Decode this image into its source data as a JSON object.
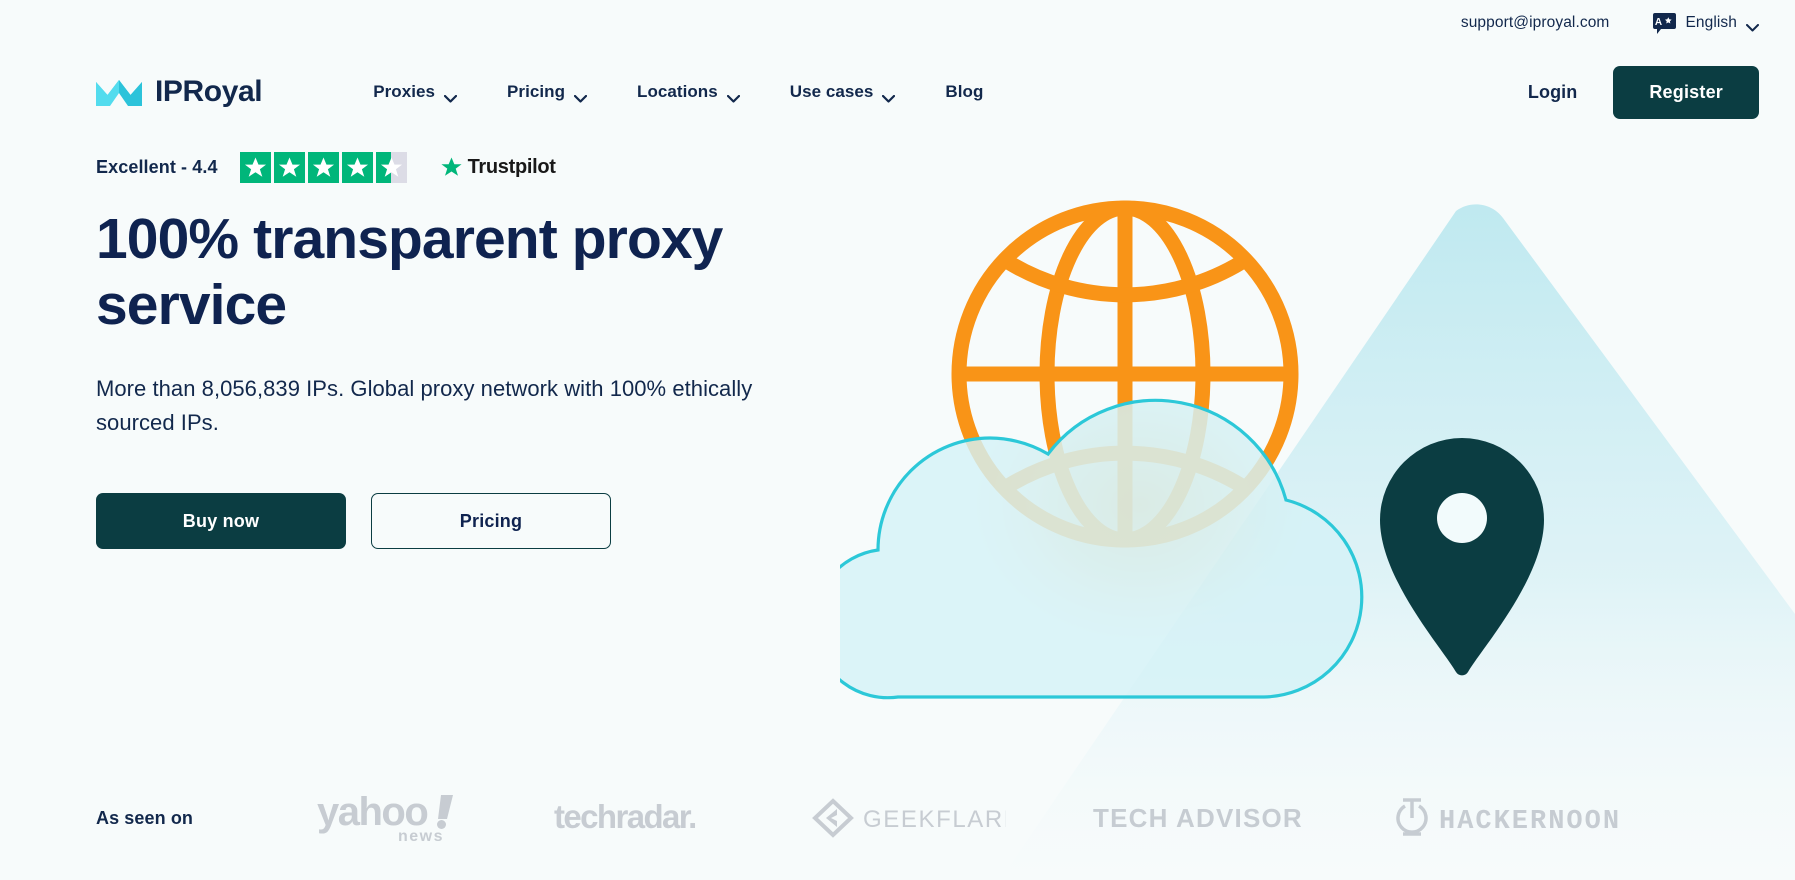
{
  "topbar": {
    "support_email": "support@iproyal.com",
    "language": "English",
    "translate_icon": "translate-icon",
    "chevron_icon": "chevron-down-icon"
  },
  "brand": {
    "name": "IPRoyal",
    "mark_icon": "crown-logo-icon",
    "mark_color": "#3ed4e8"
  },
  "nav": {
    "items": [
      {
        "label": "Proxies",
        "has_dropdown": true
      },
      {
        "label": "Pricing",
        "has_dropdown": true
      },
      {
        "label": "Locations",
        "has_dropdown": true
      },
      {
        "label": "Use cases",
        "has_dropdown": true
      },
      {
        "label": "Blog",
        "has_dropdown": false
      }
    ]
  },
  "actions": {
    "login_label": "Login",
    "register_label": "Register"
  },
  "hero": {
    "rating_text": "Excellent - 4.4",
    "rating_value": 4.4,
    "stars_total": 5,
    "stars_filled": 4,
    "stars_half": 1,
    "trustpilot_label": "Trustpilot",
    "title": "100% transparent proxy service",
    "subtitle": "More than 8,056,839 IPs. Global proxy network with 100% ethically sourced IPs.",
    "ip_count": "8,056,839",
    "cta_primary": "Buy now",
    "cta_secondary": "Pricing"
  },
  "illustration": {
    "globe_icon": "globe-icon",
    "cloud_icon": "cloud-icon",
    "pin_icon": "location-pin-icon",
    "mountain_icon": "mountain-shape-icon"
  },
  "seen_on": {
    "label": "As seen on",
    "logos": [
      {
        "name": "yahoo-news-logo",
        "text": "yahoo! news"
      },
      {
        "name": "techradar-logo",
        "text": "techradar."
      },
      {
        "name": "geekflare-logo",
        "text": "GEEKFLARE"
      },
      {
        "name": "tech-advisor-logo",
        "text": "TECH ADVISOR"
      },
      {
        "name": "hackernoon-logo",
        "text": "HACKERNOON"
      }
    ]
  },
  "colors": {
    "background": "#f7fbfb",
    "navy": "#12284c",
    "teal_dark": "#0b3d42",
    "cyan": "#2cc8d8",
    "cyan_light": "#cdeef4",
    "orange": "#f99417",
    "trustpilot_green": "#00b67a",
    "logo_gray": "#c3c9cf"
  }
}
